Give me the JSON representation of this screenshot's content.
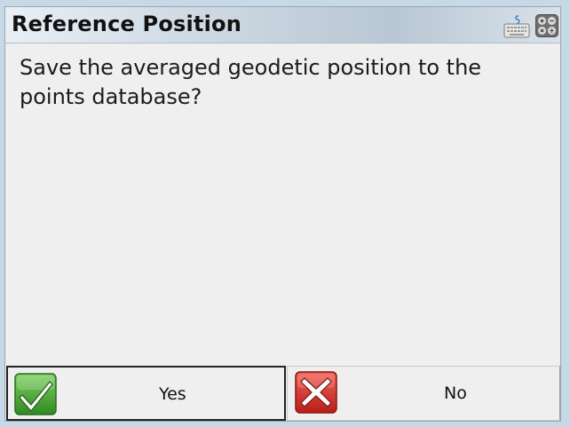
{
  "dialog": {
    "title": "Reference Position",
    "message": "Save the averaged geodetic position to the points database?",
    "icons": {
      "keyboard": "keyboard-icon",
      "calculator": "calculator-icon"
    },
    "buttons": {
      "yes_label": "Yes",
      "no_label": "No",
      "yes_icon": "checkmark-icon",
      "no_icon": "x-cross-icon"
    }
  },
  "colors": {
    "yes_icon": "#3f9b2f",
    "no_icon": "#d0302b",
    "title_bar": "#c7d4e0"
  }
}
